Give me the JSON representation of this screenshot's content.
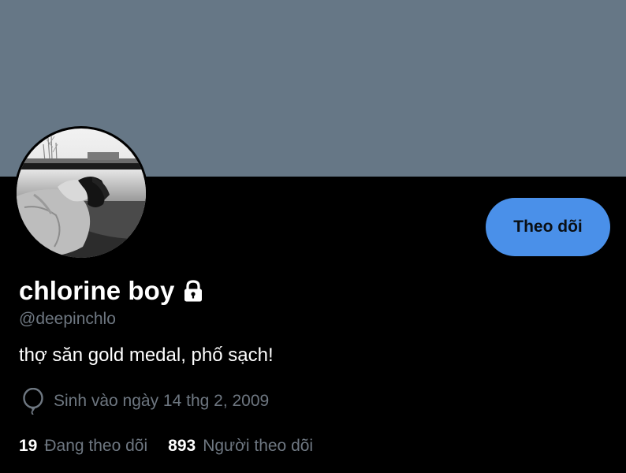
{
  "profile": {
    "display_name": "chlorine boy",
    "handle": "@deepinchlo",
    "bio": "thợ săn gold medal, phố sạch!",
    "birth": "Sinh vào ngày 14 thg 2, 2009",
    "protected": true
  },
  "actions": {
    "follow_label": "Theo dõi"
  },
  "stats": {
    "following_count": "19",
    "following_label": "Đang theo dõi",
    "followers_count": "893",
    "followers_label": "Người theo dõi"
  },
  "icons": {
    "lock": "lock-icon",
    "birthday": "balloon-icon"
  },
  "colors": {
    "banner": "#667786",
    "background": "#000000",
    "accent": "#4a90e9",
    "secondary_text": "#6e7781",
    "primary_text": "#ffffff"
  }
}
